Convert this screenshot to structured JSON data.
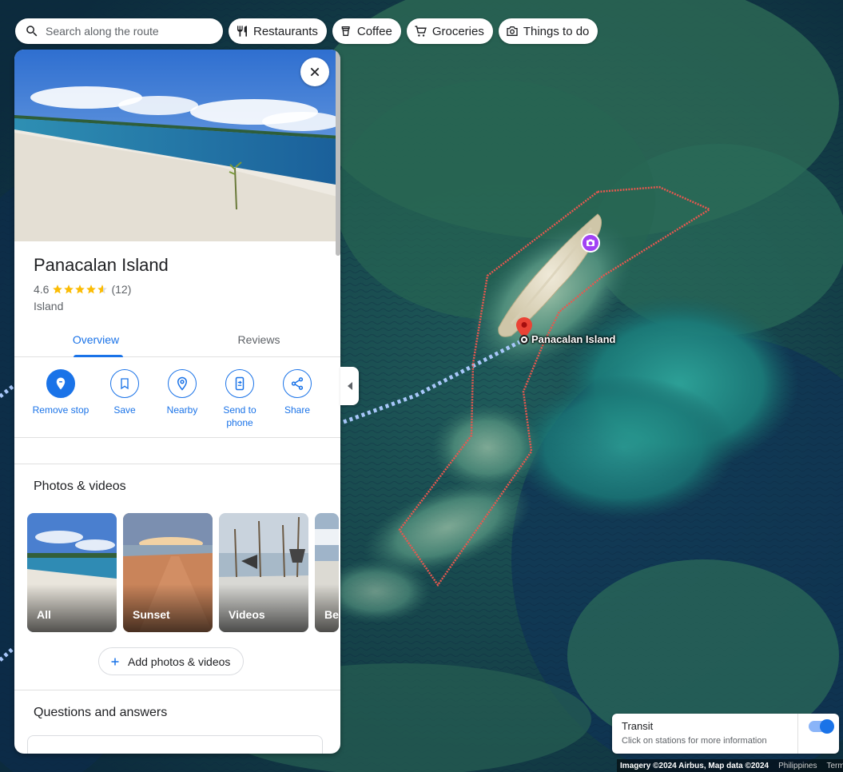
{
  "search": {
    "placeholder": "Search along the route"
  },
  "chips": [
    {
      "label": "Restaurants",
      "icon": "fork-knife-icon"
    },
    {
      "label": "Coffee",
      "icon": "coffee-icon"
    },
    {
      "label": "Groceries",
      "icon": "cart-icon"
    },
    {
      "label": "Things to do",
      "icon": "camera-icon"
    }
  ],
  "place": {
    "name": "Panacalan Island",
    "rating": "4.6",
    "stars": 4.6,
    "review_count": "(12)",
    "category": "Island"
  },
  "tabs": [
    {
      "label": "Overview",
      "active": true
    },
    {
      "label": "Reviews",
      "active": false
    }
  ],
  "actions": [
    {
      "label": "Remove stop",
      "icon": "remove-stop-icon"
    },
    {
      "label": "Save",
      "icon": "bookmark-icon"
    },
    {
      "label": "Nearby",
      "icon": "nearby-icon"
    },
    {
      "label": "Send to phone",
      "icon": "send-to-phone-icon"
    },
    {
      "label": "Share",
      "icon": "share-icon"
    }
  ],
  "photos_section": {
    "title": "Photos & videos",
    "cards": [
      "All",
      "Sunset",
      "Videos",
      "Be"
    ],
    "add_label": "Add photos & videos"
  },
  "qa_section": {
    "title": "Questions and answers"
  },
  "map": {
    "place_label": "Panacalan Island"
  },
  "transit": {
    "title": "Transit",
    "subtitle": "Click on stations for more information",
    "enabled": true
  },
  "attribution": {
    "imagery": "Imagery ©2024 Airbus, Map data ©2024",
    "region": "Philippines",
    "terms": "Terms"
  },
  "colors": {
    "accent": "#1a73e8",
    "boundary": "#e8584f",
    "route": "#a8c7fa",
    "poi_photo": "#a142f4",
    "pin": "#ea4335"
  }
}
